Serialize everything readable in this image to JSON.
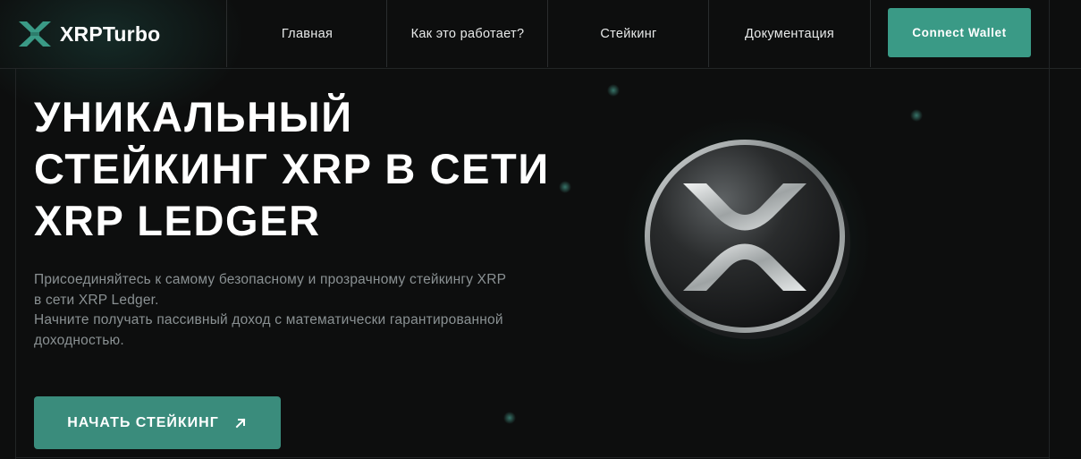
{
  "brand": {
    "name": "XRPTurbo",
    "logo_icon": "xrp-turbo-logo-icon",
    "accent": "#3a9a86"
  },
  "nav": {
    "items": [
      {
        "label": "Главная"
      },
      {
        "label": "Как это работает?"
      },
      {
        "label": "Стейкинг"
      },
      {
        "label": "Документация"
      }
    ],
    "connect_label": "Connect Wallet"
  },
  "hero": {
    "title_lines": [
      "УНИКАЛЬНЫЙ",
      "СТЕЙКИНГ XRP В СЕТИ",
      "XRP LEDGER"
    ],
    "description_lines": [
      "Присоединяйтесь к самому безопасному и прозрачному стейкингу XRP",
      "в сети XRP Ledger.",
      "Начните получать пассивный доход с математически гарантированной",
      "доходностью."
    ],
    "cta_label": "НАЧАТЬ СТЕЙКИНГ",
    "cta_icon": "arrow-up-right-icon",
    "illustration_icon": "xrp-coin-icon"
  },
  "colors": {
    "background": "#0d0e0e",
    "button_primary": "#3a8c7c",
    "text_muted": "#8a9193"
  }
}
